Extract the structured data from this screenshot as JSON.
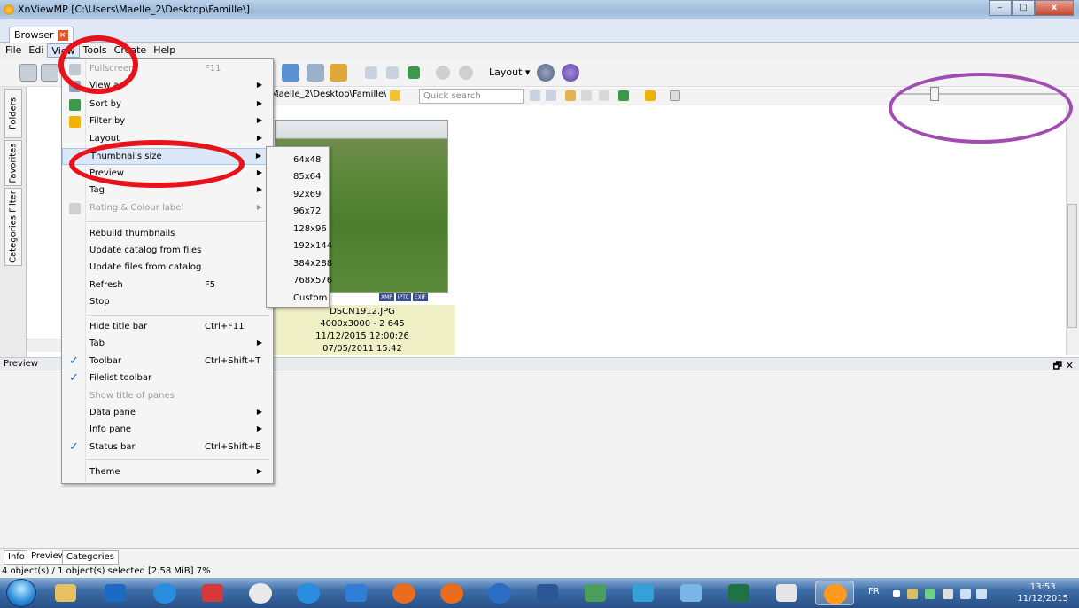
{
  "window": {
    "title": "XnViewMP [C:\\Users\\Maelle_2\\Desktop\\Famille\\]",
    "buttons": [
      "–",
      "□",
      "x"
    ]
  },
  "tabs": {
    "browser": "Browser"
  },
  "menubar": {
    "file": "File",
    "edit": "Edi",
    "view": "View",
    "tools": "Tools",
    "create": "Create",
    "help": "Help"
  },
  "toolbar": {
    "layout_label": "Layout ▾"
  },
  "addressbar": {
    "path": "Maelle_2\\Desktop\\Famille\\ ▾",
    "search_placeholder": "Quick search"
  },
  "left_tabs": {
    "folders": "Folders",
    "favorites": "Favorites",
    "categories_filter": "Categories Filter"
  },
  "view_menu": {
    "items": [
      {
        "label": "Fullscreen",
        "shortcut": "F11",
        "disabled": true
      },
      {
        "label": "View as",
        "submenu": true
      },
      {
        "label": "Sort by",
        "submenu": true
      },
      {
        "label": "Filter by",
        "submenu": true
      },
      {
        "label": "Layout",
        "submenu": true
      },
      {
        "label": "Thumbnails size",
        "submenu": true,
        "highlighted": true
      },
      {
        "label": "Preview",
        "submenu": true
      },
      {
        "label": "Tag",
        "submenu": true
      },
      {
        "label": "Rating & Colour label",
        "submenu": true,
        "disabled": true
      },
      {
        "label": "Rebuild thumbnails"
      },
      {
        "label": "Update catalog from files"
      },
      {
        "label": "Update files from catalog"
      },
      {
        "label": "Refresh",
        "shortcut": "F5"
      },
      {
        "label": "Stop"
      },
      {
        "label": "Hide title bar",
        "shortcut": "Ctrl+F11"
      },
      {
        "label": "Tab",
        "submenu": true
      },
      {
        "label": "Toolbar",
        "shortcut": "Ctrl+Shift+T",
        "checked": true
      },
      {
        "label": "Filelist toolbar",
        "checked": true
      },
      {
        "label": "Show title of panes",
        "disabled": true
      },
      {
        "label": "Data pane",
        "submenu": true
      },
      {
        "label": "Info pane",
        "submenu": true
      },
      {
        "label": "Status bar",
        "shortcut": "Ctrl+Shift+B",
        "checked": true
      },
      {
        "label": "Theme",
        "submenu": true
      }
    ]
  },
  "thumb_sizes": [
    "64x48",
    "85x64",
    "92x69",
    "96x72",
    "128x96",
    "192x144",
    "384x288",
    "768x576",
    "Custom"
  ],
  "file": {
    "name": "DSCN1912.JPG",
    "dims": "4000x3000 - 2 645",
    "date1": "11/12/2015 12:00:26",
    "date2": "07/05/2011 15:42",
    "tags": [
      "XMP",
      "IPTC",
      "EXIF"
    ]
  },
  "preview": {
    "title": "Preview",
    "controls": "🗗 ✕"
  },
  "bottom_tabs": {
    "info": "Info",
    "preview": "Preview",
    "categories": "Categories"
  },
  "status": {
    "text": "4 object(s) / 1 object(s) selected [2.58 MiB]  7%"
  },
  "taskbar": {
    "lang": "FR",
    "time": "13:53",
    "date": "11/12/2015"
  },
  "colors": {
    "annotation_red": "#e8121a",
    "annotation_purple": "#a24bb0",
    "menu_highlight": "#dce8f7"
  }
}
